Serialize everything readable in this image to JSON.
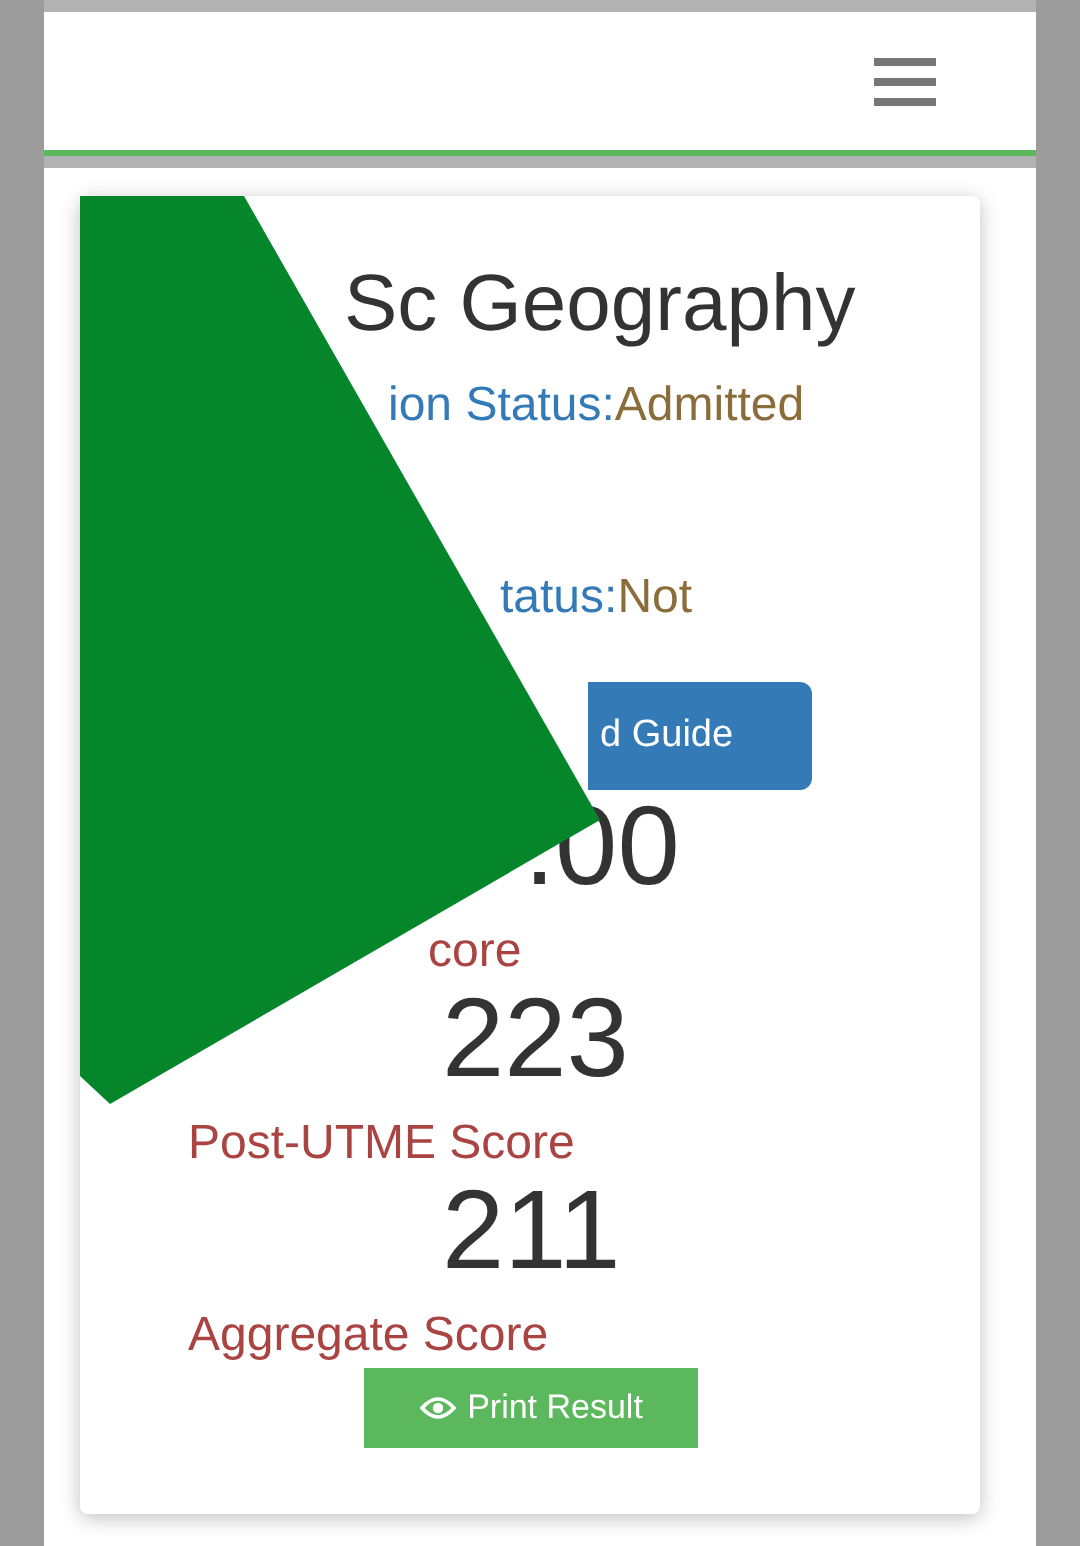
{
  "program_title": "Sc Geography",
  "admission_status": {
    "label": "ion Status:",
    "value": "Admitted"
  },
  "second_status": {
    "label": "tatus:",
    "value": "Not"
  },
  "guide_button": "d Guide",
  "score_value": ".00",
  "scores": [
    {
      "label": "core",
      "value": "223"
    },
    {
      "label": "Post-UTME Score",
      "value": "211"
    },
    {
      "label": "Aggregate Score"
    }
  ],
  "print_button": "Print Result"
}
